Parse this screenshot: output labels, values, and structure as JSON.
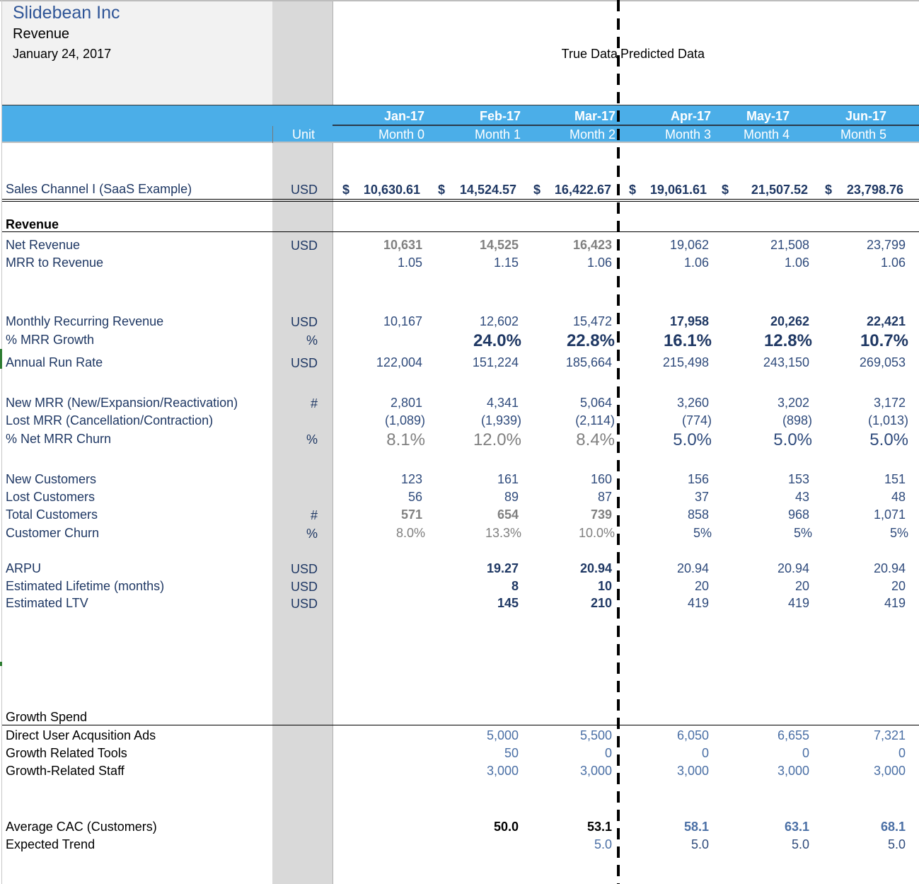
{
  "header": {
    "company": "Slidebean Inc",
    "sheet": "Revenue",
    "date": "January 24, 2017",
    "true_data_label": "True Data",
    "predicted_data_label": "Predicted Data",
    "unit_label": "Unit"
  },
  "columns": [
    {
      "month": "Jan-17",
      "index": "Month 0"
    },
    {
      "month": "Feb-17",
      "index": "Month 1"
    },
    {
      "month": "Mar-17",
      "index": "Month 2"
    },
    {
      "month": "Apr-17",
      "index": "Month 3"
    },
    {
      "month": "May-17",
      "index": "Month 4"
    },
    {
      "month": "Jun-17",
      "index": "Month 5"
    }
  ],
  "sales_channel": {
    "label": "Sales Channel I (SaaS Example)",
    "unit": "USD",
    "currency_symbol": "$",
    "values": [
      "10,630.61",
      "14,524.57",
      "16,422.67",
      "19,061.61",
      "21,507.52",
      "23,798.76"
    ]
  },
  "sections": {
    "revenue_title": "Revenue",
    "growth_spend_title": "Growth Spend"
  },
  "rows": {
    "net_revenue": {
      "label": "Net Revenue",
      "unit": "USD",
      "values": [
        "10,631",
        "14,525",
        "16,423",
        "19,062",
        "21,508",
        "23,799"
      ]
    },
    "mrr_to_revenue": {
      "label": "MRR to Revenue",
      "unit": "",
      "values": [
        "1.05",
        "1.15",
        "1.06",
        "1.06",
        "1.06",
        "1.06"
      ]
    },
    "mrr": {
      "label": "Monthly Recurring Revenue",
      "unit": "USD",
      "values": [
        "10,167",
        "12,602",
        "15,472",
        "17,958",
        "20,262",
        "22,421"
      ]
    },
    "mrr_growth": {
      "label": "% MRR Growth",
      "unit": "%",
      "values": [
        "",
        "24.0%",
        "22.8%",
        "16.1%",
        "12.8%",
        "10.7%"
      ]
    },
    "arr": {
      "label": "Annual Run Rate",
      "unit": "USD",
      "values": [
        "122,004",
        "151,224",
        "185,664",
        "215,498",
        "243,150",
        "269,053"
      ]
    },
    "new_mrr": {
      "label": "New MRR (New/Expansion/Reactivation)",
      "unit": "#",
      "values": [
        "2,801",
        "4,341",
        "5,064",
        "3,260",
        "3,202",
        "3,172"
      ]
    },
    "lost_mrr": {
      "label": "Lost MRR (Cancellation/Contraction)",
      "unit": "",
      "values": [
        "(1,089)",
        "(1,939)",
        "(2,114)",
        "(774)",
        "(898)",
        "(1,013)"
      ]
    },
    "net_mrr_churn": {
      "label": "% Net MRR Churn",
      "unit": "%",
      "values": [
        "8.1%",
        "12.0%",
        "8.4%",
        "5.0%",
        "5.0%",
        "5.0%"
      ]
    },
    "new_customers": {
      "label": "New Customers",
      "unit": "",
      "values": [
        "123",
        "161",
        "160",
        "156",
        "153",
        "151"
      ]
    },
    "lost_customers": {
      "label": "Lost Customers",
      "unit": "",
      "values": [
        "56",
        "89",
        "87",
        "37",
        "43",
        "48"
      ]
    },
    "total_customers": {
      "label": "Total Customers",
      "unit": "#",
      "values": [
        "571",
        "654",
        "739",
        "858",
        "968",
        "1,071"
      ]
    },
    "customer_churn": {
      "label": "Customer Churn",
      "unit": "%",
      "values": [
        "8.0%",
        "13.3%",
        "10.0%",
        "5%",
        "5%",
        "5%"
      ]
    },
    "arpu": {
      "label": "ARPU",
      "unit": "USD",
      "values": [
        "",
        "19.27",
        "20.94",
        "20.94",
        "20.94",
        "20.94"
      ]
    },
    "lifetime": {
      "label": "Estimated Lifetime (months)",
      "unit": "USD",
      "values": [
        "",
        "8",
        "10",
        "20",
        "20",
        "20"
      ]
    },
    "ltv": {
      "label": "Estimated LTV",
      "unit": "USD",
      "values": [
        "",
        "145",
        "210",
        "419",
        "419",
        "419"
      ]
    },
    "ads": {
      "label": "Direct User Acqusition Ads",
      "unit": "",
      "values": [
        "",
        "5,000",
        "5,500",
        "6,050",
        "6,655",
        "7,321"
      ]
    },
    "tools": {
      "label": "Growth Related Tools",
      "unit": "",
      "values": [
        "",
        "50",
        "0",
        "0",
        "0",
        "0"
      ]
    },
    "staff": {
      "label": "Growth-Related Staff",
      "unit": "",
      "values": [
        "",
        "3,000",
        "3,000",
        "3,000",
        "3,000",
        "3,000"
      ]
    },
    "cac": {
      "label": "Average CAC (Customers)",
      "unit": "",
      "values": [
        "",
        "50.0",
        "53.1",
        "58.1",
        "63.1",
        "68.1"
      ]
    },
    "trend": {
      "label": "Expected Trend",
      "unit": "",
      "values": [
        "",
        "",
        "5.0",
        "5.0",
        "5.0",
        "5.0"
      ]
    }
  },
  "colors": {
    "header_blue": "#4baee8",
    "title_blue": "#2f5597",
    "text_navy": "#1f3864",
    "gray_value": "#808080",
    "unit_column": "#d9d9d9"
  }
}
